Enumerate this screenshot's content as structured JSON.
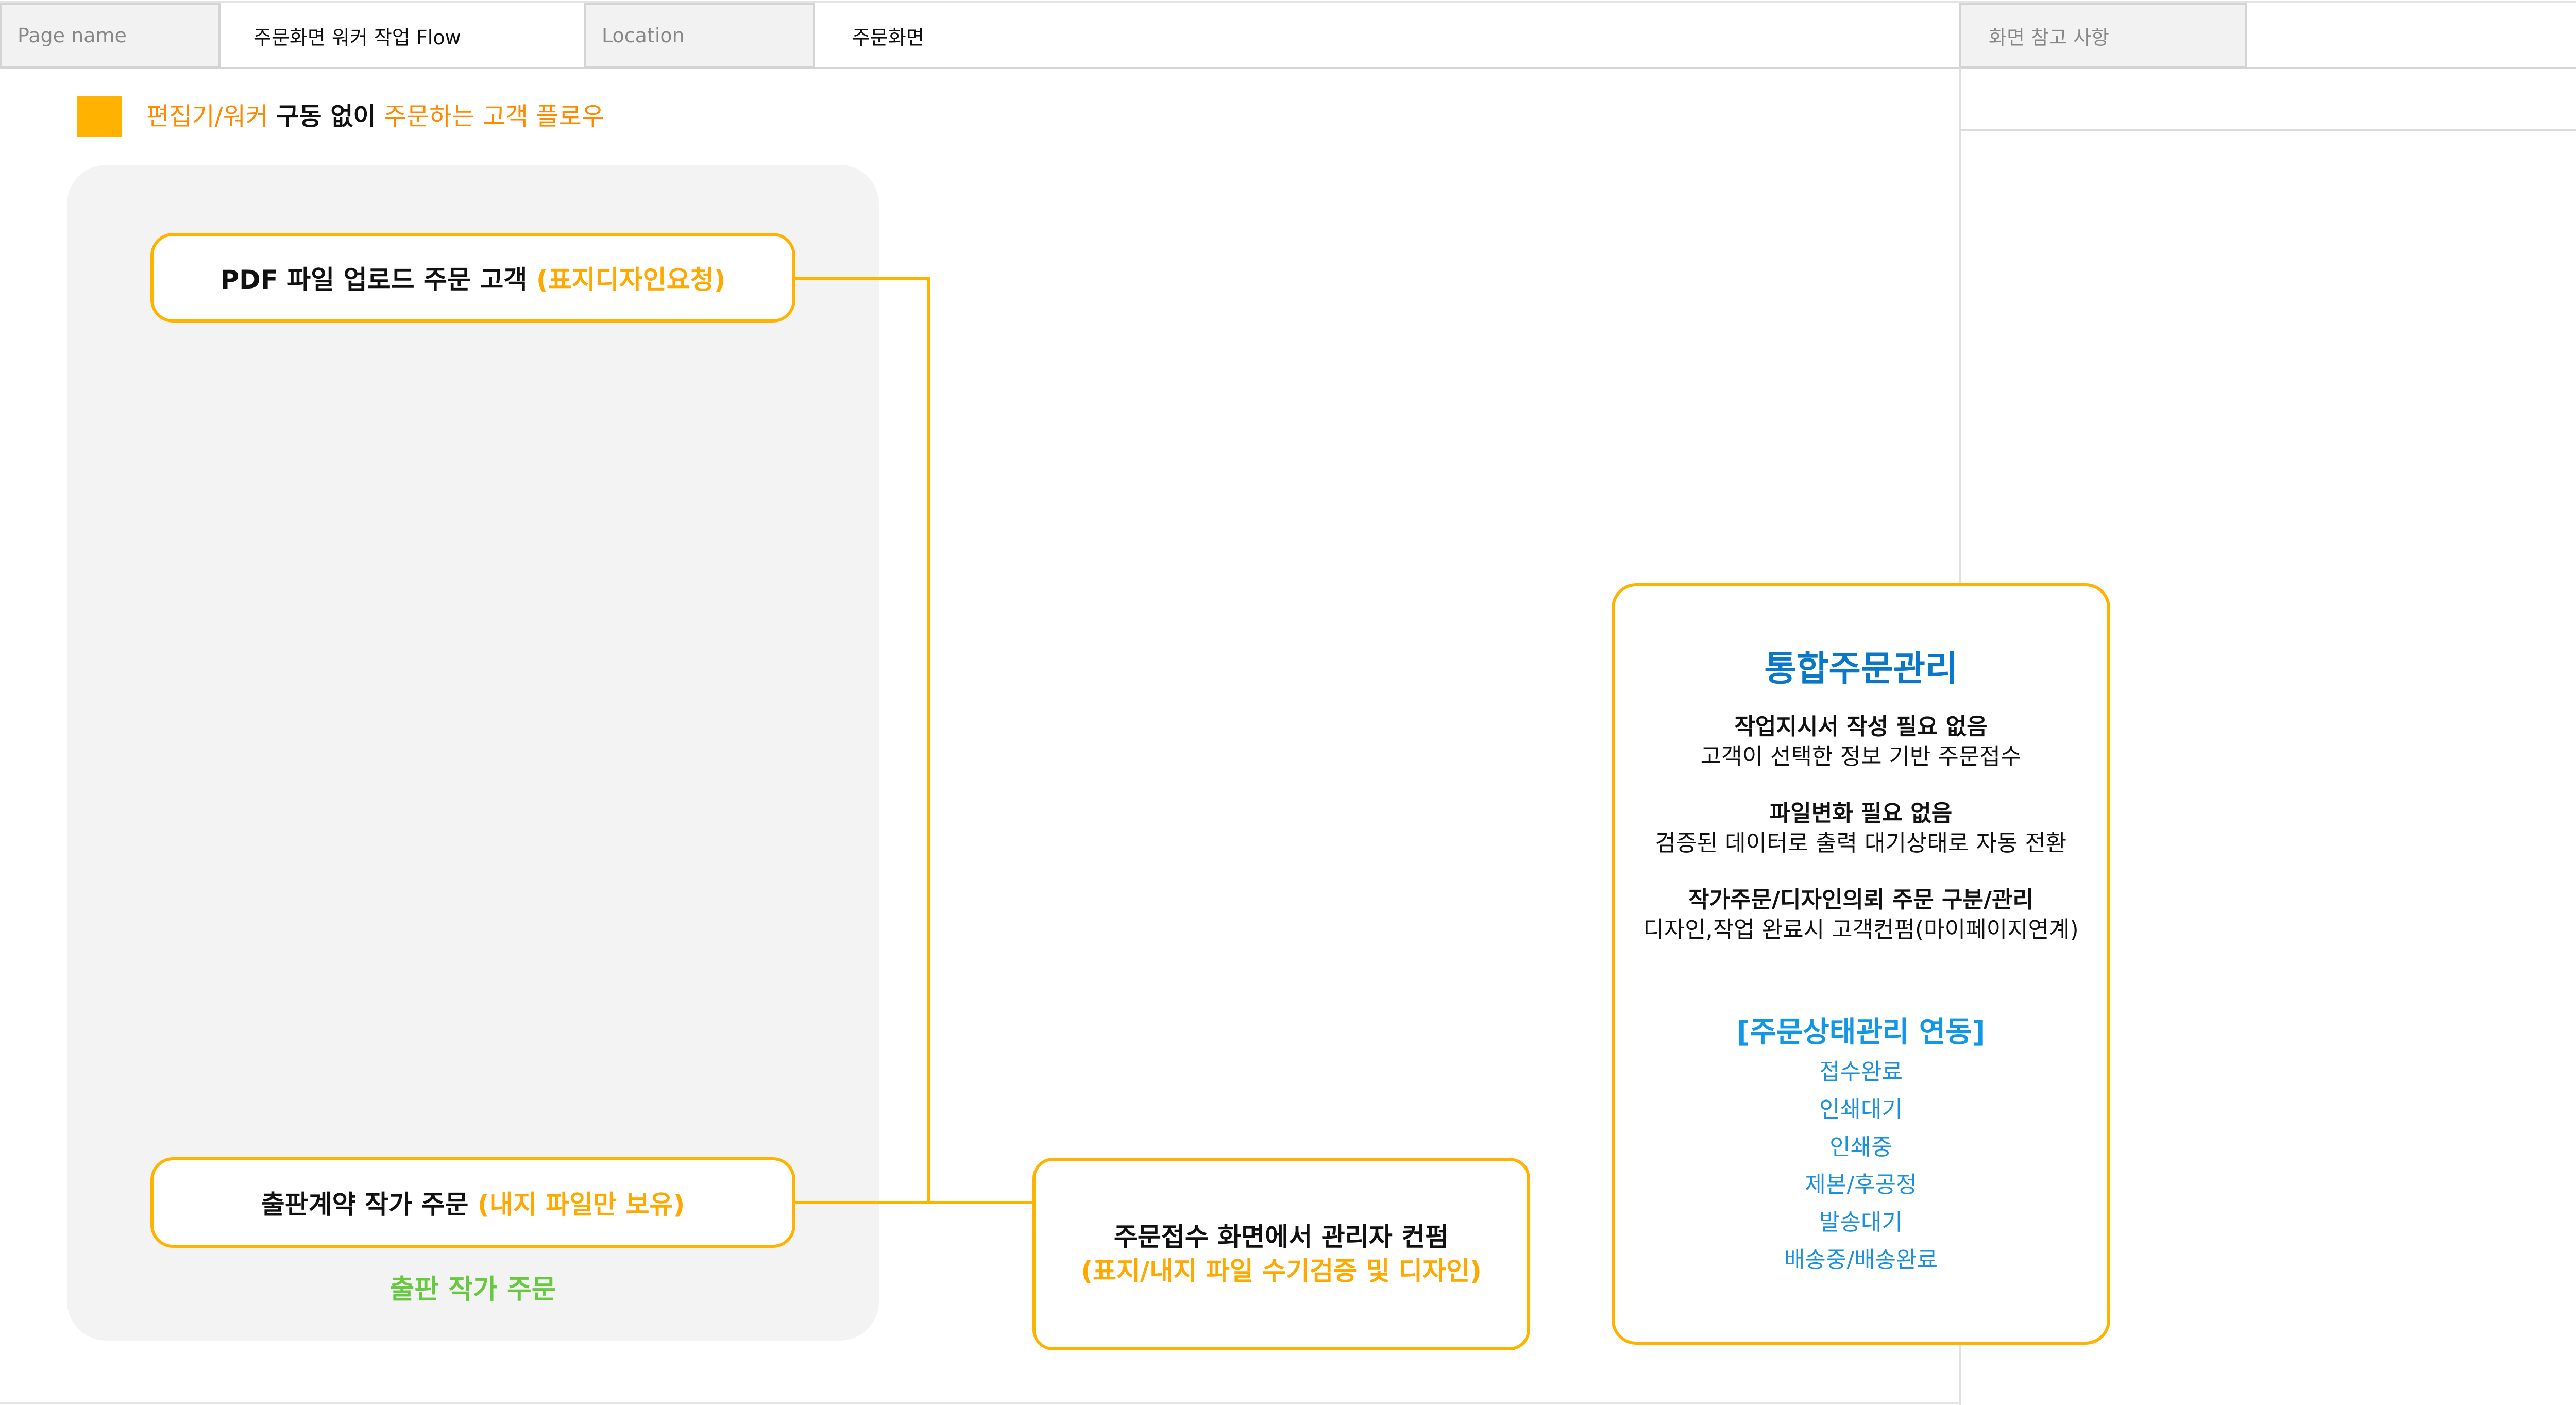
{
  "header": {
    "page_name_label": "Page name",
    "page_name_value": "주문화면 워커 작업 Flow",
    "location_label": "Location",
    "location_value": "주문화면",
    "reference_label": "화면 참고 사항"
  },
  "legend": {
    "part1": "편집기/워커 ",
    "part2": "구동 없이",
    "part3": " 주문하는 고객 플로우"
  },
  "flow": {
    "box_pdf": {
      "main": "PDF 파일 업로드 주문 고객 ",
      "accent": "(표지디자인요청)"
    },
    "box_contract": {
      "main": "출판계약 작가 주문 ",
      "accent": "(내지 파일만 보유)"
    },
    "panel_label": "출판 작가 주문",
    "center_box": {
      "line1": "주문접수 화면에서 관리자 컨펌",
      "line2": "(표지/내지 파일 수기검증 및 디자인)"
    }
  },
  "integrated": {
    "title": "통합주문관리",
    "items": [
      {
        "heading": "작업지시서 작성 필요 없음",
        "text": "고객이 선택한 정보 기반 주문접수"
      },
      {
        "heading": "파일변화 필요 없음",
        "text": "검증된 데이터로 출력 대기상태로 자동 전환"
      },
      {
        "heading": "작가주문/디자인의뢰 주문 구분/관리",
        "text": "디자인,작업 완료시 고객컨펌(마이페이지연계)"
      }
    ],
    "status_title": "[주문상태관리 연동]",
    "statuses": [
      "접수완료",
      "인쇄대기",
      "인쇄중",
      "제본/후공정",
      "발송대기",
      "배송중/배송완료"
    ]
  },
  "colors": {
    "accent_orange": "#ffb300",
    "text_orange": "#ff8a00",
    "title_blue": "#0a77c8",
    "status_blue": "#1b8fe0",
    "green": "#66c93f"
  }
}
